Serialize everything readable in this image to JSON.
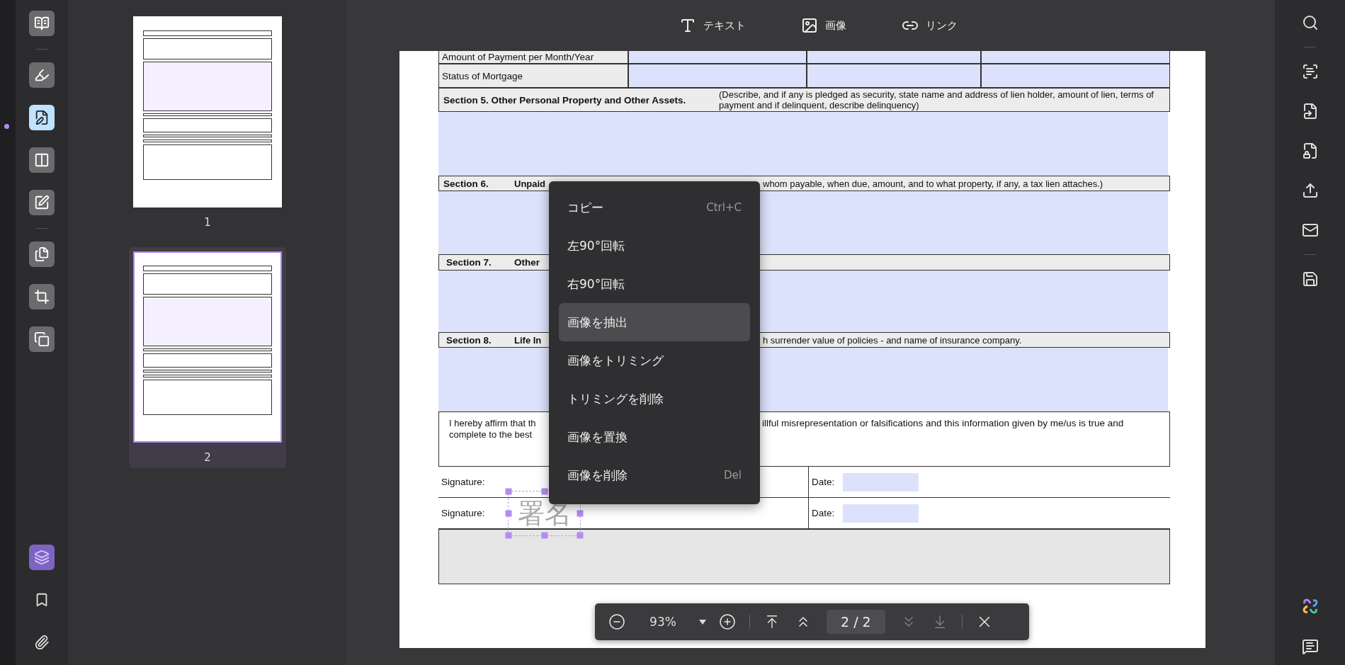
{
  "left_tools": [
    {
      "selected": false
    },
    {
      "selected": false
    },
    {
      "selected": true
    },
    {
      "selected": false
    },
    {
      "selected": false
    },
    {
      "selected": false
    },
    {
      "selected": false
    },
    {
      "selected": false
    }
  ],
  "bottom_tools": [
    {
      "selected": true
    },
    {
      "selected": false
    },
    {
      "selected": false
    }
  ],
  "thumbnails": [
    {
      "label": "1",
      "selected": false
    },
    {
      "label": "2",
      "selected": true
    }
  ],
  "top_tools": [
    {
      "kind": "text",
      "label": "テキスト"
    },
    {
      "kind": "image",
      "label": "画像"
    },
    {
      "kind": "link",
      "label": "リンク"
    }
  ],
  "document": {
    "amount_label": "Amount of Payment per Month/Year",
    "mortgage_label": "Status of Mortgage",
    "section5": {
      "title": "Section 5. Other Personal Property and Other Assets.",
      "note": "(Describe, and if any is pledged as security, state name and address of lien holder, amount of lien, terms of payment and if delinquent, describe delinquency)"
    },
    "section6": {
      "number": "Section 6.",
      "title": "Unpaid",
      "note": "whom payable, when due, amount, and to what property, if any, a tax lien attaches.)"
    },
    "section7": {
      "number": "Section 7.",
      "title": "Other"
    },
    "section8": {
      "number": "Section 8.",
      "title": "Life In",
      "note": "h surrender value of policies - and name of insurance company."
    },
    "affirm_left": [
      "I hereby affirm that th",
      "complete to the best"
    ],
    "affirm_right": "illful misrepresentation or falsifications and this information given by me/us is true and",
    "signatures": [
      {
        "label": "Signature:",
        "date_label": "Date:"
      },
      {
        "label": "Signature:",
        "date_label": "Date:"
      }
    ],
    "signature_image": "署名"
  },
  "context_menu": [
    {
      "label": "コピー",
      "shortcut": "Ctrl+C",
      "selected": false
    },
    {
      "label": "左90°回転",
      "selected": false
    },
    {
      "label": "右90°回転",
      "selected": false
    },
    {
      "label": "画像を抽出",
      "selected": true
    },
    {
      "label": "画像をトリミング",
      "selected": false
    },
    {
      "label": "トリミングを削除",
      "selected": false
    },
    {
      "label": "画像を置換",
      "selected": false
    },
    {
      "label": "画像を削除",
      "shortcut": "Del",
      "selected": false
    }
  ],
  "page_toolbar": {
    "zoom": "93%",
    "page": "2 / 2",
    "first_disabled": false,
    "prev_disabled": false,
    "next_disabled": true,
    "last_disabled": true
  }
}
